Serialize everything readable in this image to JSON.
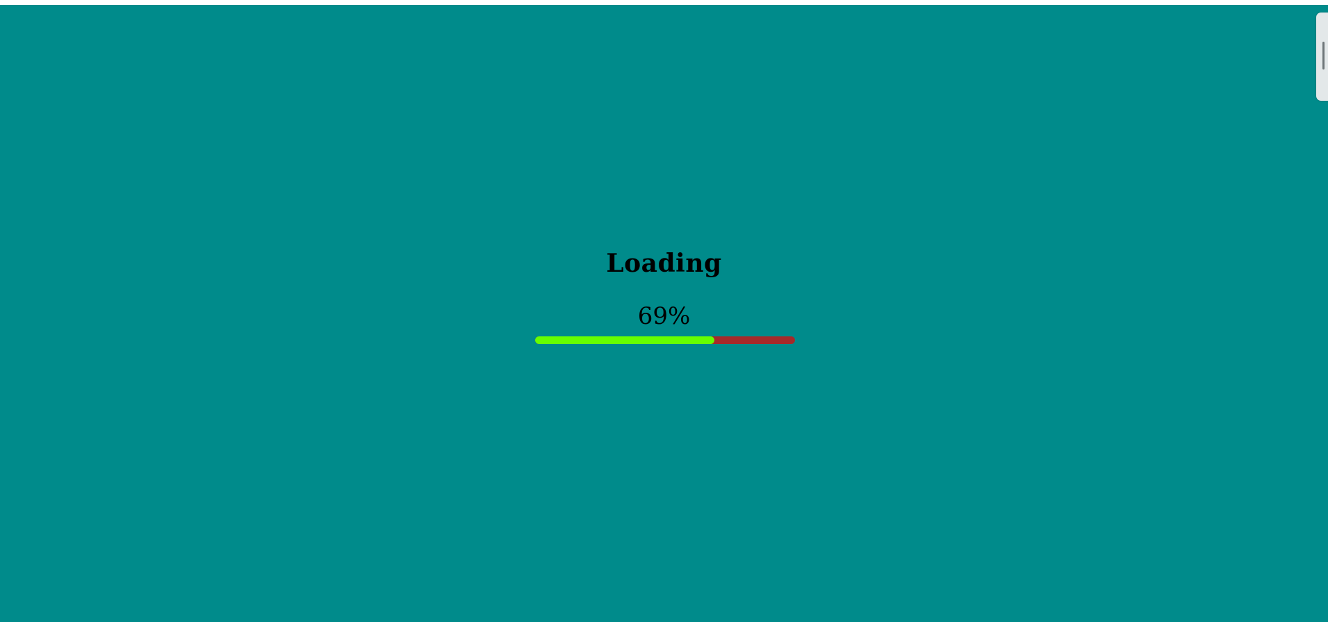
{
  "loading": {
    "title": "Loading",
    "percent": 69,
    "percent_label": "69%"
  },
  "colors": {
    "background": "#008b8b",
    "progress_fill": "#66ff00",
    "progress_track": "#a52a2a",
    "text": "#000000"
  }
}
